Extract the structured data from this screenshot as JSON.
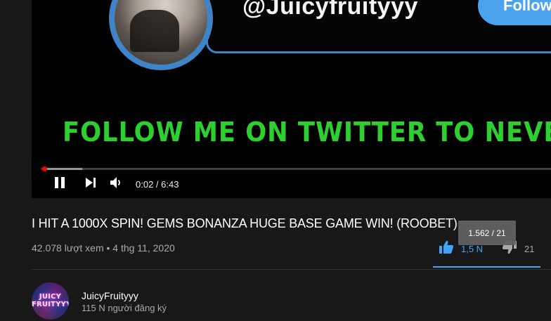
{
  "player": {
    "overlay": {
      "handle": "@Juicyfruityyy",
      "follow_label": "Follow",
      "banner": "FOLLOW ME ON TWITTER TO NEVER MISS"
    },
    "progress": {
      "played_fraction": 0.005,
      "buffered_fraction": 0.08
    },
    "time_display": "0:02 / 6:43",
    "icons": {
      "pause": "pause-icon",
      "next": "skip-next-icon",
      "volume": "volume-icon"
    }
  },
  "video": {
    "title": "I HIT A 1000X SPIN! GEMS BONANZA HUGE BASE GAME WIN! (ROOBET)",
    "meta": "42.078 lượt xem • 4 thg 11, 2020",
    "likes": "1,5 N",
    "dislikes": "21",
    "tooltip": "1.562 / 21",
    "like_ratio": 0.987
  },
  "channel": {
    "avatar_text_line1": "JUICY",
    "avatar_text_line2": "FRUITYYY",
    "name": "JuicyFruityyy",
    "subscribers": "115 N người đăng ký"
  },
  "colors": {
    "accent_blue": "#3ea6ff",
    "banner_green": "#2dd12f",
    "progress_red": "#ff0000",
    "background": "#181818"
  }
}
